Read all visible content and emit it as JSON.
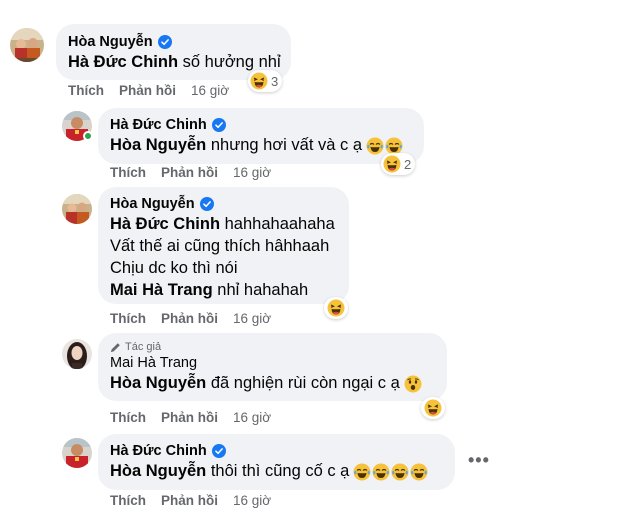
{
  "comments": [
    {
      "author": "Hòa Nguyễn",
      "mention": "Hà Đức Chinh",
      "text": " số hưởng nhỉ",
      "reaction_count": "3",
      "like": "Thích",
      "reply": "Phản hồi",
      "time": "16 giờ"
    },
    {
      "author": "Hà Đức Chinh",
      "mention": "Hòa Nguyễn",
      "text": " nhưng hơi vất và c ạ",
      "reaction_count": "2",
      "like": "Thích",
      "reply": "Phản hồi",
      "time": "16 giờ"
    },
    {
      "author": "Hòa Nguyễn",
      "lines": {
        "l1_mention": "Hà Đức Chinh",
        "l1_text": " hahhahaahaha",
        "l2": "Vất thế ai cũng thích hâhhaah",
        "l3": "Chịu dc ko thì nói",
        "l4_mention": "Mai Hà Trang",
        "l4_text": " nhỉ hahahah"
      },
      "like": "Thích",
      "reply": "Phản hồi",
      "time": "16 giờ"
    },
    {
      "author_tag": "Tác giả",
      "author": "Mai Hà Trang",
      "mention": "Hòa Nguyễn",
      "text": " đã nghiện rùi còn ngại c ạ",
      "like": "Thích",
      "reply": "Phản hồi",
      "time": "16 giờ"
    },
    {
      "author": "Hà Đức Chinh",
      "mention": "Hòa Nguyễn",
      "text": " thôi thì cũng cố c ạ",
      "like": "Thích",
      "reply": "Phản hồi",
      "time": "16 giờ"
    }
  ],
  "colors": {
    "bubble": "#f0f2f5",
    "meta": "#65676b",
    "verified": "#1877f2",
    "online": "#31a24c",
    "emoji": "#f7c23b"
  },
  "icons": [
    "verified-badge-icon",
    "laughing-emoji-icon",
    "tears-of-joy-emoji-icon",
    "hushed-emoji-icon",
    "pencil-icon",
    "more-options-icon"
  ]
}
